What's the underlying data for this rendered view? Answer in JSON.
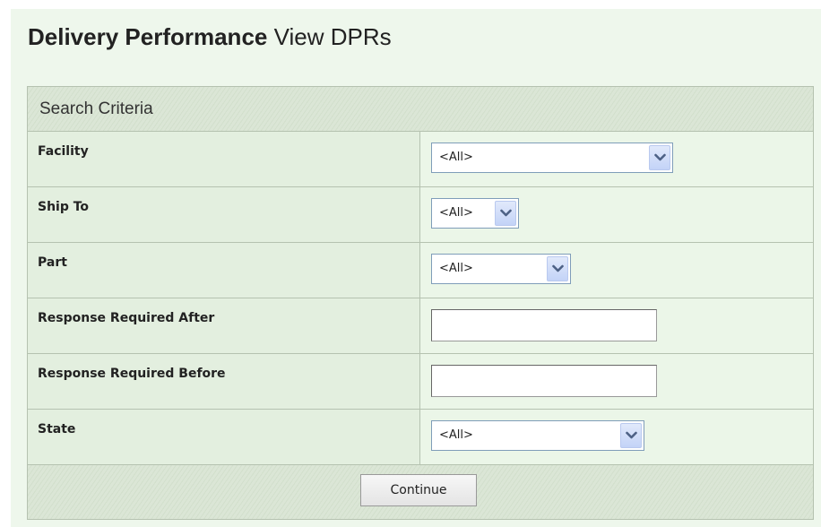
{
  "header": {
    "title_strong": "Delivery Performance",
    "title_light": "View DPRs"
  },
  "search": {
    "heading": "Search Criteria",
    "fields": [
      {
        "label": "Facility",
        "type": "select",
        "value": "<All>"
      },
      {
        "label": "Ship To",
        "type": "select",
        "value": "<All>"
      },
      {
        "label": "Part",
        "type": "select",
        "value": "<All>"
      },
      {
        "label": "Response Required After",
        "type": "text",
        "value": ""
      },
      {
        "label": "Response Required Before",
        "type": "text",
        "value": ""
      },
      {
        "label": "State",
        "type": "select",
        "value": "<All>"
      }
    ],
    "continue_label": "Continue"
  },
  "colors": {
    "page_background": "#eef7ec",
    "panel_border": "#b5c2b0",
    "dropdown_accent": "#c3d3f7",
    "arrow_icon": "#4d6185"
  },
  "icons": {
    "dropdown_arrow": "chevron-down-icon"
  }
}
